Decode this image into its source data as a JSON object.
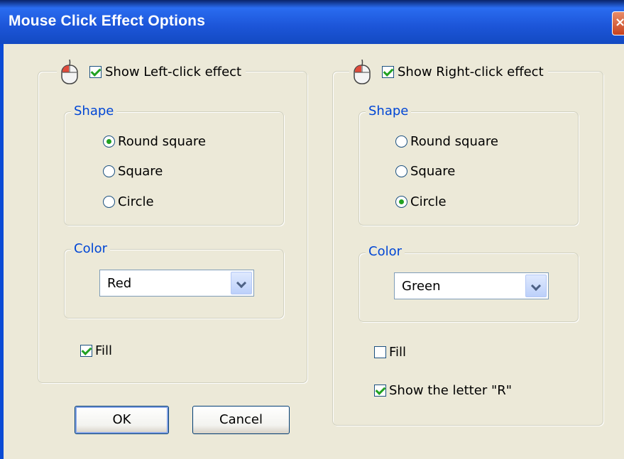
{
  "window": {
    "title": "Mouse Click Effect Options",
    "close_symbol": "×"
  },
  "left_panel": {
    "header_label": "Show Left-click effect",
    "header_checked": true,
    "shape_legend": "Shape",
    "shape_options": [
      {
        "label": "Round square",
        "selected": true
      },
      {
        "label": "Square",
        "selected": false
      },
      {
        "label": "Circle",
        "selected": false
      }
    ],
    "color_legend": "Color",
    "color_value": "Red",
    "fill_label": "Fill",
    "fill_checked": true
  },
  "right_panel": {
    "header_label": "Show Right-click effect",
    "header_checked": true,
    "shape_legend": "Shape",
    "shape_options": [
      {
        "label": "Round square",
        "selected": false
      },
      {
        "label": "Square",
        "selected": false
      },
      {
        "label": "Circle",
        "selected": true
      }
    ],
    "color_legend": "Color",
    "color_value": "Green",
    "fill_label": "Fill",
    "fill_checked": false,
    "letter_label": "Show the letter \"R\"",
    "letter_checked": true
  },
  "buttons": {
    "ok": "OK",
    "cancel": "Cancel"
  },
  "icons": {
    "mouse": "mouse-icon",
    "close": "close-icon",
    "dropdown": "chevron-down-icon"
  },
  "colors": {
    "legend_text": "#0046d5",
    "check_mark": "#21a121",
    "title_bar": "#1c55d8"
  }
}
